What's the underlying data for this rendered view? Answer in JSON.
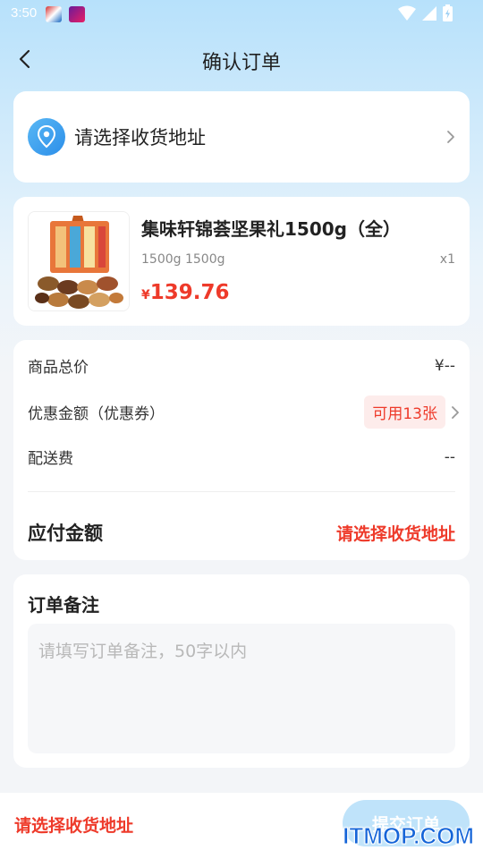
{
  "status_bar": {
    "time": "3:50"
  },
  "header": {
    "title": "确认订单"
  },
  "address": {
    "placeholder_text": "请选择收货地址"
  },
  "product": {
    "name": "集味轩锦荟坚果礼1500g（全）",
    "spec": "1500g 1500g",
    "quantity": "x1",
    "price_symbol": "¥",
    "price": "139.76"
  },
  "summary": {
    "total_label": "商品总价",
    "total_value": "¥--",
    "discount_label": "优惠金额（优惠券）",
    "coupon_badge": "可用13张",
    "shipping_label": "配送费",
    "shipping_value": "--",
    "payable_label": "应付金额",
    "payable_value": "请选择收货地址"
  },
  "remark": {
    "title": "订单备注",
    "placeholder": "请填写订单备注，50字以内",
    "value": ""
  },
  "bottom_bar": {
    "hint": "请选择收货地址",
    "submit_label": "提交订单"
  },
  "watermark": "ITMOP.COM",
  "colors": {
    "accent_red": "#ee3a2a",
    "accent_blue": "#2b8ee9",
    "submit_disabled": "#bfe3fa"
  },
  "icons": {
    "back": "chevron-left-icon",
    "location": "location-pin-icon",
    "chevron": "chevron-right-icon",
    "wifi": "wifi-icon",
    "signal": "signal-icon",
    "battery": "battery-icon"
  }
}
